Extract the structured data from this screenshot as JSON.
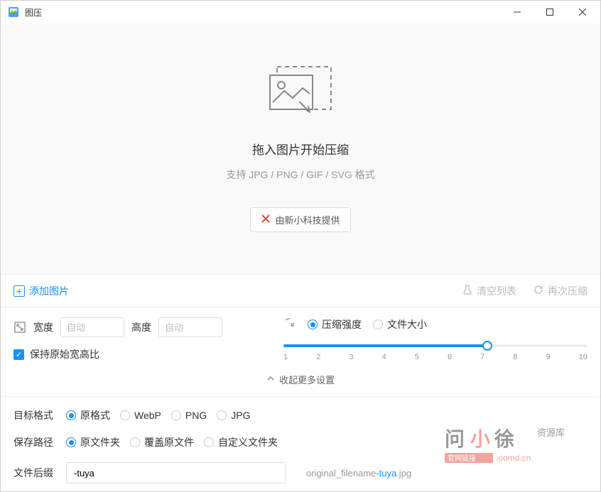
{
  "app": {
    "title": "图压"
  },
  "dropzone": {
    "title": "拖入图片开始压缩",
    "subtitle": "支持 JPG / PNG / GIF / SVG 格式",
    "provider": "由新小科技提供"
  },
  "toolbar": {
    "add": "添加图片",
    "clear": "清空列表",
    "recompress": "再次压缩"
  },
  "dimensions": {
    "width_label": "宽度",
    "width_placeholder": "自动",
    "width_value": "",
    "height_label": "高度",
    "height_placeholder": "自动",
    "height_value": "",
    "keep_ratio": "保持原始宽高比"
  },
  "compression": {
    "strength_label": "压缩强度",
    "filesize_label": "文件大小",
    "selected": "strength",
    "value": 7,
    "ticks": [
      "1",
      "2",
      "3",
      "4",
      "5",
      "6",
      "7",
      "8",
      "9",
      "10"
    ]
  },
  "collapse": {
    "label": "收起更多设置"
  },
  "format": {
    "label": "目标格式",
    "options": [
      {
        "label": "原格式",
        "checked": true
      },
      {
        "label": "WebP",
        "checked": false
      },
      {
        "label": "PNG",
        "checked": false
      },
      {
        "label": "JPG",
        "checked": false
      }
    ]
  },
  "save_path": {
    "label": "保存路径",
    "options": [
      {
        "label": "原文件夹",
        "checked": true
      },
      {
        "label": "覆盖原文件",
        "checked": false
      },
      {
        "label": "自定义文件夹",
        "checked": false
      }
    ]
  },
  "suffix": {
    "label": "文件后缀",
    "value": "-tuya",
    "preview_prefix": "original_filename",
    "preview_suffix": "-tuya",
    "preview_ext": ".jpg"
  },
  "watermark": {
    "line1": "问小徐",
    "line2": "资源库",
    "line3": "官网链接:oomd.cn"
  }
}
